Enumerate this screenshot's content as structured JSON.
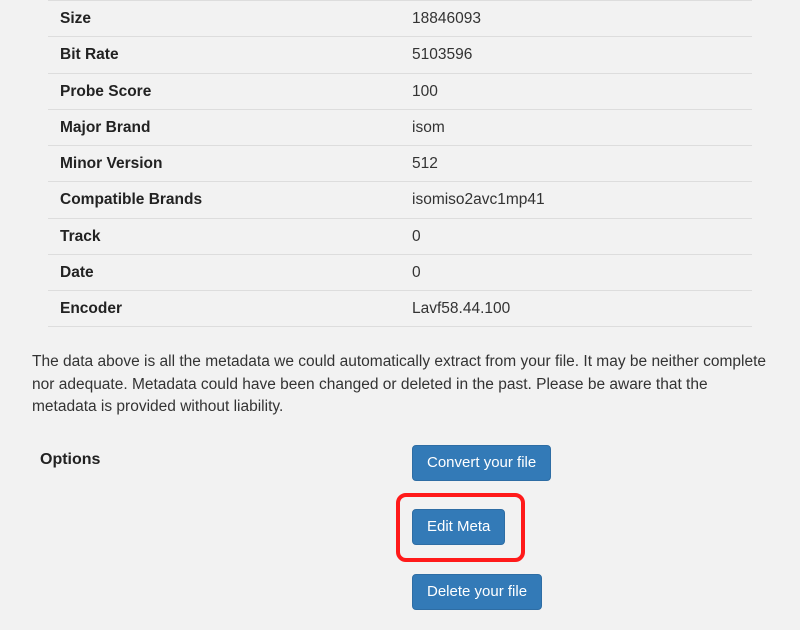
{
  "metadata_rows": [
    {
      "label": "Size",
      "value": "18846093"
    },
    {
      "label": "Bit Rate",
      "value": "5103596"
    },
    {
      "label": "Probe Score",
      "value": "100"
    },
    {
      "label": "Major Brand",
      "value": "isom"
    },
    {
      "label": "Minor Version",
      "value": "512"
    },
    {
      "label": "Compatible Brands",
      "value": "isomiso2avc1mp41"
    },
    {
      "label": "Track",
      "value": "0"
    },
    {
      "label": "Date",
      "value": "0"
    },
    {
      "label": "Encoder",
      "value": "Lavf58.44.100"
    }
  ],
  "description_text": "The data above is all the metadata we could automatically extract from your file. It may be neither complete nor adequate. Metadata could have been changed or deleted in the past. Please be aware that the metadata is provided without liability.",
  "options": {
    "heading": "Options",
    "convert_label": "Convert your file",
    "edit_label": "Edit Meta",
    "delete_label": "Delete your file"
  }
}
